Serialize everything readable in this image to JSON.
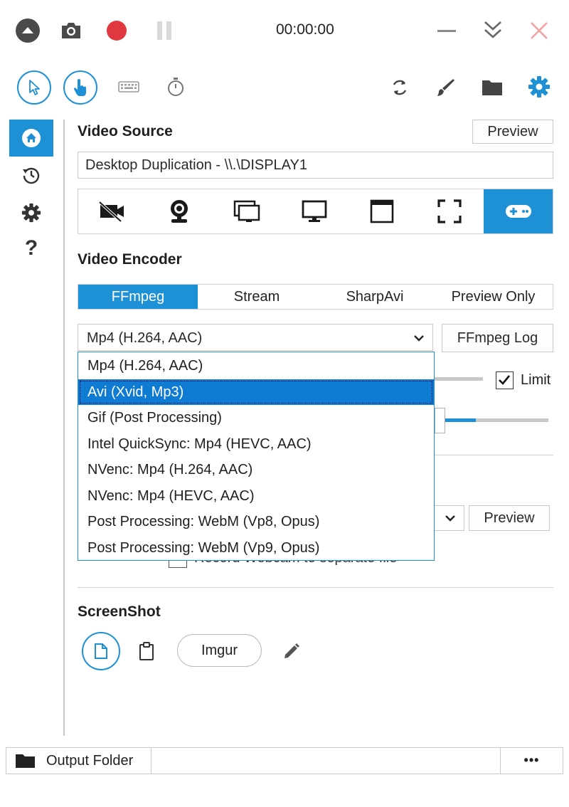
{
  "titlebar": {
    "timer": "00:00:00",
    "icons": [
      "collapse-up-icon",
      "camera-icon",
      "record-icon",
      "pause-icon",
      "minimize-icon",
      "double-chevron-down-icon",
      "close-icon"
    ]
  },
  "toolbar": {
    "left_icons": [
      "cursor-icon",
      "click-hand-icon",
      "keyboard-icon",
      "stopwatch-icon"
    ],
    "right_icons": [
      "refresh-icon",
      "brush-icon",
      "folder-icon",
      "gear-icon"
    ]
  },
  "sidebar": {
    "items": [
      "home-icon",
      "history-icon",
      "settings-icon",
      "help-icon"
    ],
    "help_label": "?"
  },
  "video_source": {
    "title": "Video Source",
    "preview_label": "Preview",
    "value": "Desktop Duplication  -  \\\\.\\DISPLAY1",
    "source_icons": [
      "no-video-icon",
      "webcam-icon",
      "screens-icon",
      "monitor-icon",
      "window-icon",
      "region-icon",
      "gamepad-icon"
    ]
  },
  "video_encoder": {
    "title": "Video Encoder",
    "tabs": [
      "FFmpeg",
      "Stream",
      "SharpAvi",
      "Preview Only"
    ],
    "selected_codec": "Mp4 (H.264, AAC)",
    "log_button": "FFmpeg Log",
    "limit_label": "Limit",
    "preview_label": "Preview",
    "partial_text": "Record Webcam to separate file"
  },
  "codec_dropdown": {
    "options": [
      "Mp4 (H.264, AAC)",
      "Avi (Xvid, Mp3)",
      "Gif (Post Processing)",
      "Intel QuickSync: Mp4 (HEVC, AAC)",
      "NVenc: Mp4 (H.264, AAC)",
      "NVenc: Mp4 (HEVC, AAC)",
      "Post Processing: WebM (Vp8, Opus)",
      "Post Processing: WebM (Vp9, Opus)"
    ],
    "highlighted": "Avi (Xvid, Mp3)"
  },
  "screenshot": {
    "title": "ScreenShot",
    "imgur_label": "Imgur"
  },
  "footer": {
    "output_folder_label": "Output Folder",
    "more_label": "•••"
  },
  "colors": {
    "accent": "#1e90d6",
    "record": "#e0383e"
  }
}
